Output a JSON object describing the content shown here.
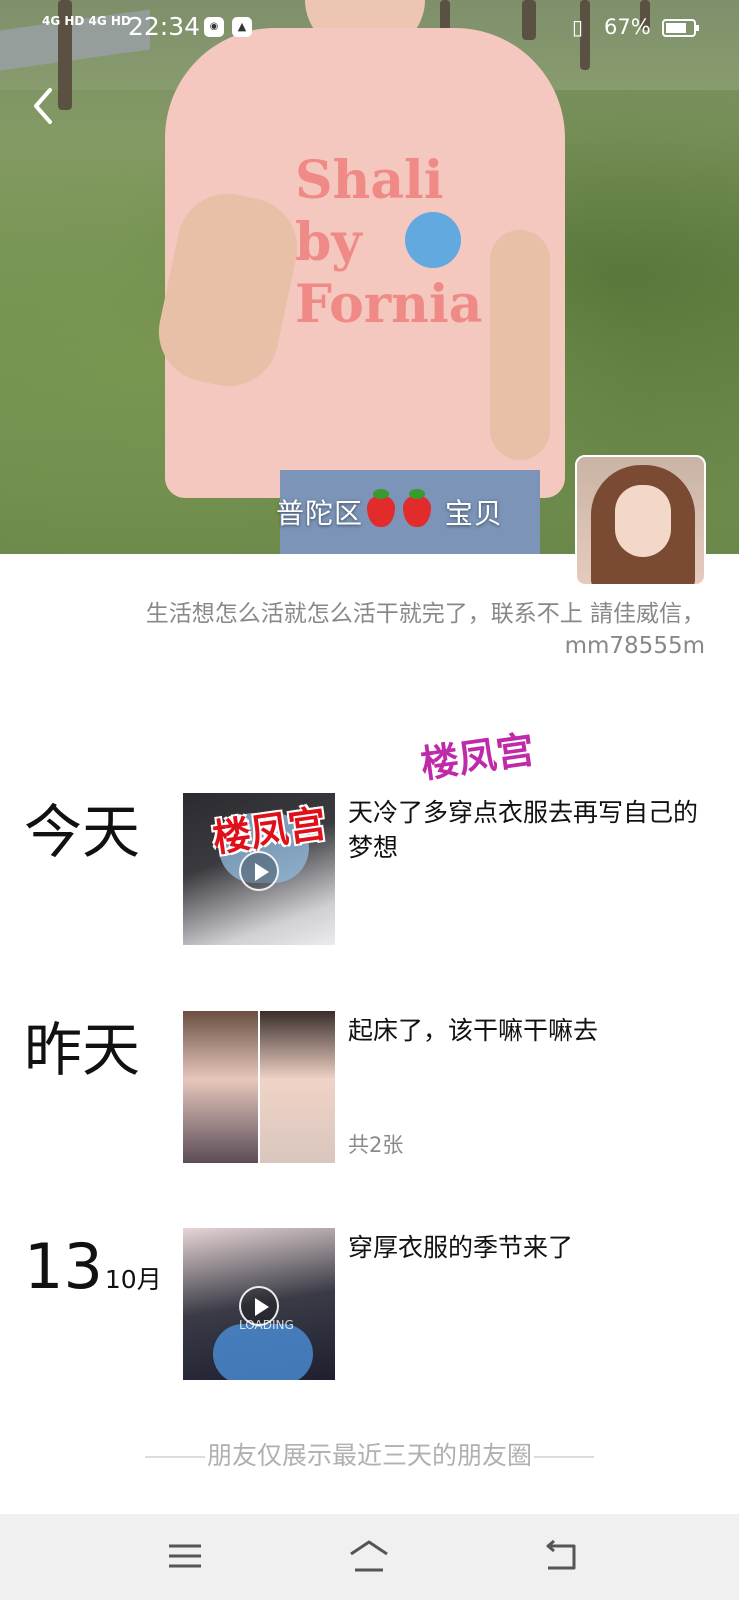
{
  "status_bar": {
    "network": "4G HD 4G HD",
    "time": "22:34",
    "battery_percent": "67%",
    "battery_level": 0.67,
    "icons": [
      "signal-icon",
      "app-notification-icon",
      "gallery-notification-icon",
      "vibrate-icon",
      "battery-icon"
    ]
  },
  "header": {
    "cover_caption_left": "普陀区",
    "cover_caption_right": "宝贝",
    "cover_print_text": "Shali by Fornia",
    "signature": "生活想怎么活就怎么活干就完了，联系不上 請佳威信，mm78555m"
  },
  "watermarks": {
    "primary": "楼凤宫",
    "secondary": "楼凤宫"
  },
  "posts": [
    {
      "date": "今天",
      "text": "天冷了多穿点衣服去再写自己的梦想",
      "media": "video"
    },
    {
      "date": "昨天",
      "text": "起床了，该干嘛干嘛去",
      "media": "photos",
      "count": "共2张"
    },
    {
      "date_day": "13",
      "date_month": "10月",
      "text": "穿厚衣服的季节来了",
      "media": "video",
      "loading": "LOADING"
    }
  ],
  "footer_note": "朋友仅展示最近三天的朋友圈",
  "navbar": {
    "icons": [
      "menu-icon",
      "home-icon",
      "back-nav-icon"
    ]
  }
}
